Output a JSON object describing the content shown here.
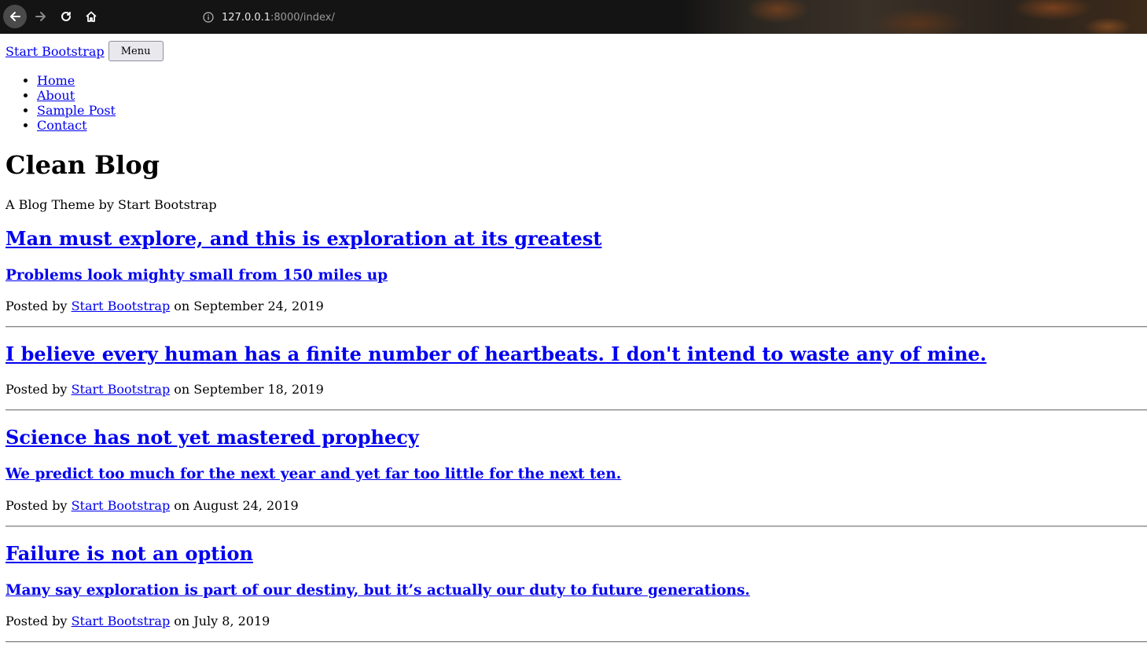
{
  "browser": {
    "url_host": "127.0.0.1",
    "url_path": ":8000/index/"
  },
  "nav": {
    "brand": "Start Bootstrap",
    "menu_button": "Menu",
    "items": [
      {
        "label": "Home"
      },
      {
        "label": "About"
      },
      {
        "label": "Sample Post"
      },
      {
        "label": "Contact"
      }
    ]
  },
  "header": {
    "title": "Clean Blog",
    "subtitle": "A Blog Theme by Start Bootstrap"
  },
  "posts": [
    {
      "title": "Man must explore, and this is exploration at its greatest",
      "subtitle": "Problems look mighty small from 150 miles up",
      "posted_by": "Posted by",
      "author": "Start Bootstrap",
      "date_text": "on September 24, 2019"
    },
    {
      "title": "I believe every human has a finite number of heartbeats. I don't intend to waste any of mine.",
      "subtitle": "",
      "posted_by": "Posted by",
      "author": "Start Bootstrap",
      "date_text": "on September 18, 2019"
    },
    {
      "title": "Science has not yet mastered prophecy",
      "subtitle": "We predict too much for the next year and yet far too little for the next ten.",
      "posted_by": "Posted by",
      "author": "Start Bootstrap",
      "date_text": "on August 24, 2019"
    },
    {
      "title": "Failure is not an option",
      "subtitle": "Many say exploration is part of our destiny, but it’s actually our duty to future generations.",
      "posted_by": "Posted by",
      "author": "Start Bootstrap",
      "date_text": "on July 8, 2019"
    }
  ]
}
